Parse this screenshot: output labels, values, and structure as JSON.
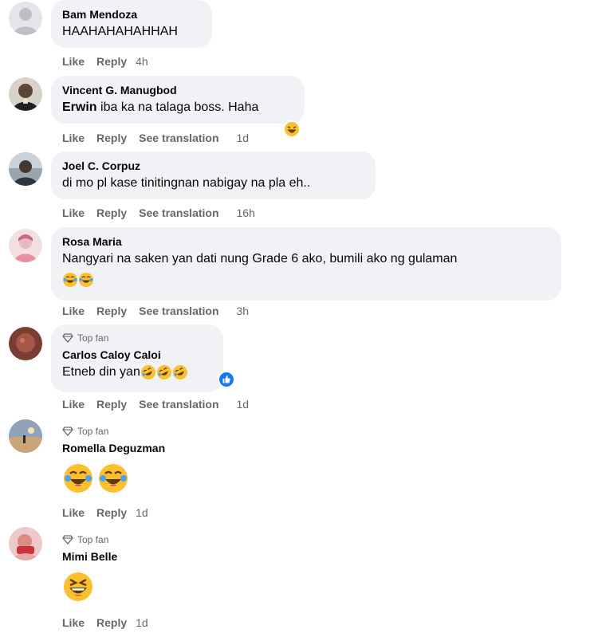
{
  "comments": [
    {
      "author": "Bam Mendoza",
      "text": "HAAHAHAHAHHAH",
      "like": "Like",
      "reply": "Reply",
      "time": "4h",
      "avatar": "default-avatar"
    },
    {
      "author": "Vincent G. Manugbod",
      "mention": "Erwin",
      "text": "iba ka na talaga boss. Haha",
      "like": "Like",
      "reply": "Reply",
      "translate": "See translation",
      "time": "1d",
      "reaction": "haha-reaction-icon"
    },
    {
      "author": "Joel C. Corpuz",
      "text": "di mo pl kase tinitingnan nabigay na pla eh..",
      "like": "Like",
      "reply": "Reply",
      "translate": "See translation",
      "time": "16h"
    },
    {
      "author": "Rosa Maria",
      "text": "Nangyari na saken yan dati nung Grade 6 ako, bumili ako ng gulaman",
      "like": "Like",
      "reply": "Reply",
      "translate": "See translation",
      "time": "3h",
      "emojis": [
        "tears-of-joy",
        "tears-of-joy"
      ]
    },
    {
      "badge": "Top fan",
      "author": "Carlos Caloy Caloi",
      "text": "Etneb din yan",
      "like": "Like",
      "reply": "Reply",
      "translate": "See translation",
      "time": "1d",
      "emojis": [
        "rolling-laughing",
        "rolling-laughing",
        "rolling-laughing"
      ],
      "reaction": "like-reaction-icon"
    },
    {
      "badge": "Top fan",
      "author": "Romella Deguzman",
      "like": "Like",
      "reply": "Reply",
      "time": "1d",
      "emojis": [
        "tears-of-joy",
        "tears-of-joy"
      ]
    },
    {
      "badge": "Top fan",
      "author": "Mimi Belle",
      "like": "Like",
      "reply": "Reply",
      "time": "1d",
      "emojis": [
        "squinting-laugh"
      ]
    }
  ],
  "colors": {
    "bubble": "#f0f2f5",
    "meta": "#65676b",
    "text": "#050505",
    "like_blue": "#1877f2",
    "emoji_yellow": "#fbc02d"
  }
}
